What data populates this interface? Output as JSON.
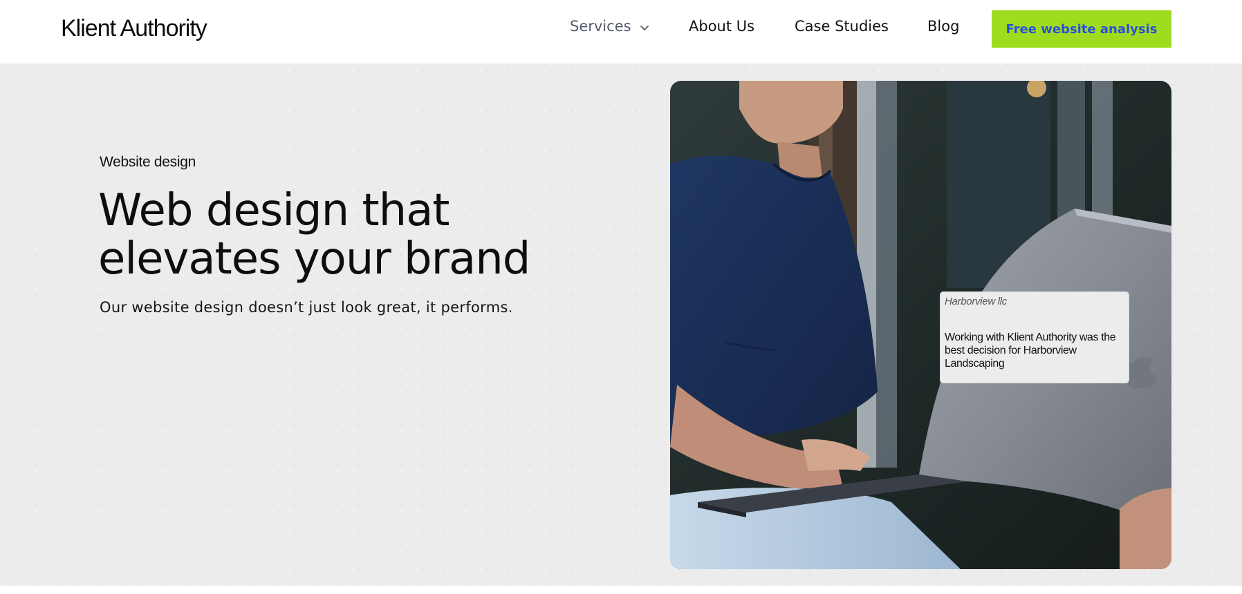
{
  "header": {
    "logo": "Klient Authority",
    "nav": {
      "services": "Services",
      "about": "About Us",
      "case_studies": "Case Studies",
      "blog": "Blog"
    },
    "cta_label": "Free website analysis"
  },
  "hero": {
    "eyebrow": "Website design",
    "headline_line1": "Web design that",
    "headline_line2": "elevates your brand",
    "subtext": "Our website design doesn’t just look great, it performs."
  },
  "testimonial": {
    "company": "Harborview llc",
    "quote": "Working with Klient Authority was the best decision for Harborview Landscaping"
  },
  "icons": {
    "services_dropdown": "chevron-down-icon"
  },
  "colors": {
    "cta_background": "#a0dc1e",
    "cta_text": "#2b50d6",
    "hero_background": "#ececec",
    "nav_services": "#55596b"
  }
}
